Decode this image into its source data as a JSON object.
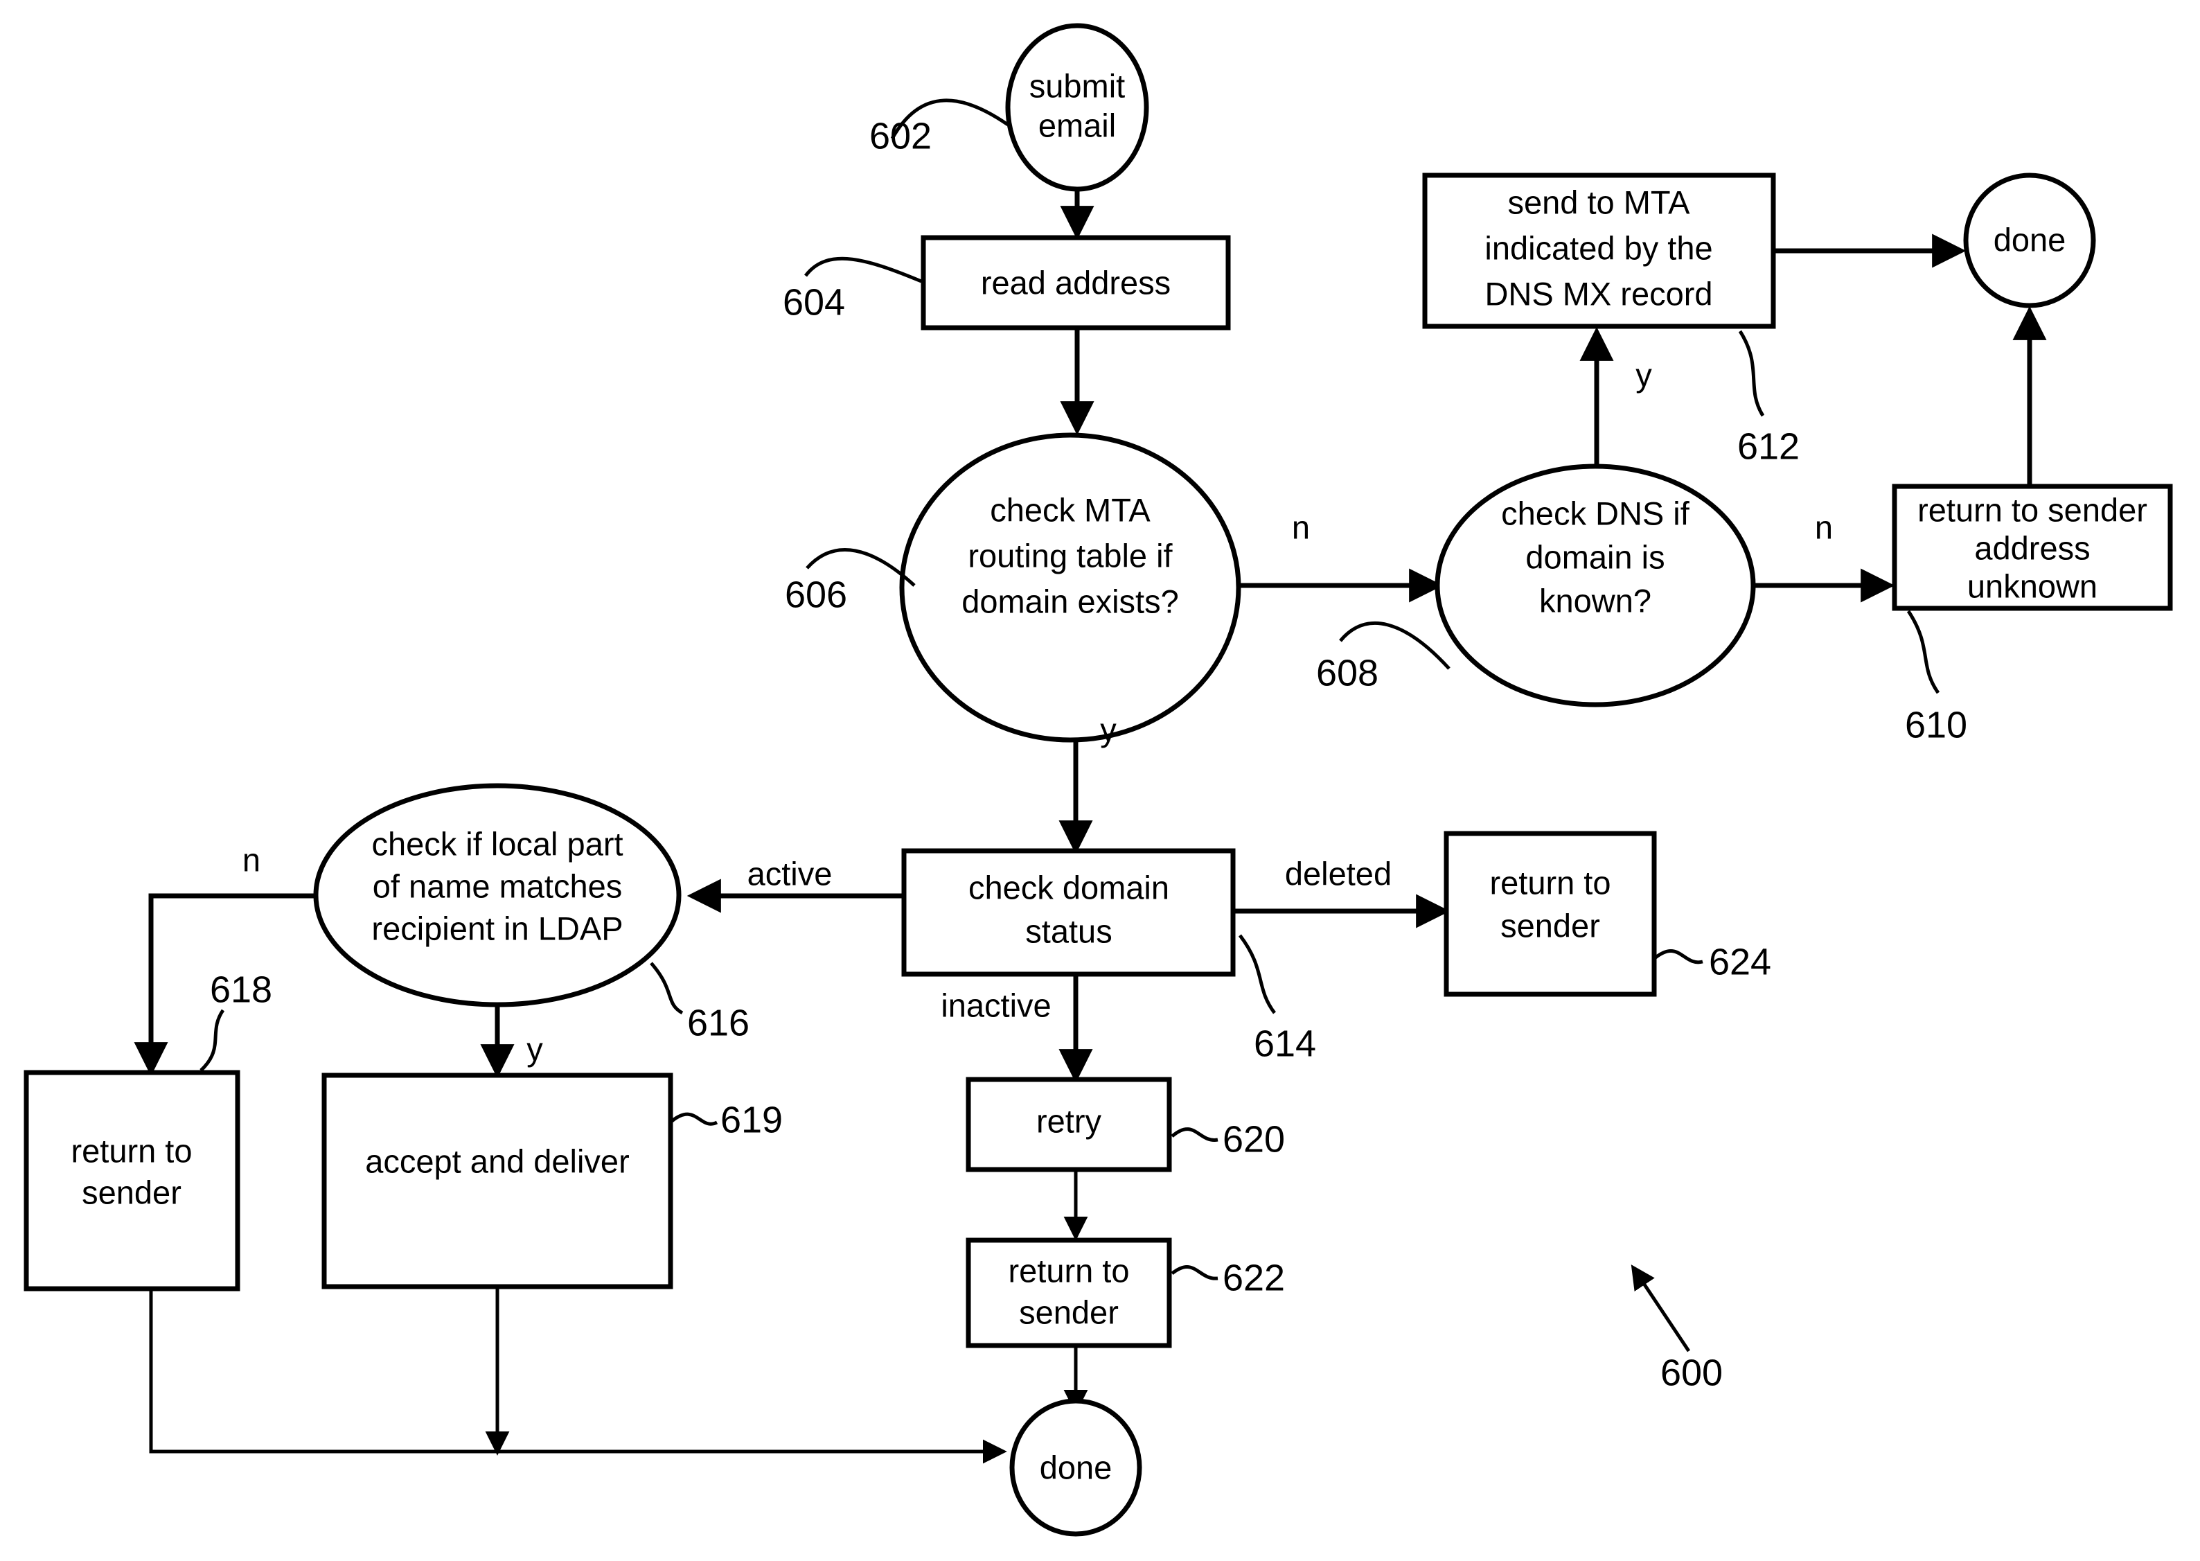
{
  "diagram": {
    "title_ref": "600",
    "type": "flowchart",
    "nodes": [
      {
        "id": "n602",
        "ref": "602",
        "shape": "ellipse",
        "lines": [
          "submit",
          "email"
        ]
      },
      {
        "id": "n604",
        "ref": "604",
        "shape": "rect",
        "lines": [
          "read address"
        ]
      },
      {
        "id": "n606",
        "ref": "606",
        "shape": "ellipse",
        "lines": [
          "check MTA",
          "routing table if",
          "domain exists?"
        ]
      },
      {
        "id": "n608",
        "ref": "608",
        "shape": "ellipse",
        "lines": [
          "check DNS if",
          "domain is",
          "known?"
        ]
      },
      {
        "id": "n610",
        "ref": "610",
        "shape": "rect",
        "lines": [
          "return to sender",
          "address",
          "unknown"
        ]
      },
      {
        "id": "n612",
        "ref": "612",
        "shape": "rect",
        "lines": [
          "send to MTA",
          "indicated by the",
          "DNS MX record"
        ]
      },
      {
        "id": "n_done_top",
        "ref": "",
        "shape": "ellipse",
        "lines": [
          "done"
        ]
      },
      {
        "id": "n614",
        "ref": "614",
        "shape": "rect",
        "lines": [
          "check domain",
          "status"
        ]
      },
      {
        "id": "n616",
        "ref": "616",
        "shape": "ellipse",
        "lines": [
          "check if local part",
          "of name matches",
          "recipient in LDAP"
        ]
      },
      {
        "id": "n618",
        "ref": "618",
        "shape": "rect",
        "lines": [
          "return to",
          "sender"
        ]
      },
      {
        "id": "n619",
        "ref": "619",
        "shape": "rect",
        "lines": [
          "accept and deliver"
        ]
      },
      {
        "id": "n620",
        "ref": "620",
        "shape": "rect",
        "lines": [
          "retry"
        ]
      },
      {
        "id": "n622",
        "ref": "622",
        "shape": "rect",
        "lines": [
          "return to",
          "sender"
        ]
      },
      {
        "id": "n624",
        "ref": "624",
        "shape": "rect",
        "lines": [
          "return to",
          "sender"
        ]
      },
      {
        "id": "n_done_bottom",
        "ref": "",
        "shape": "ellipse",
        "lines": [
          "done"
        ]
      }
    ],
    "edge_labels": {
      "mta_no": "n",
      "mta_yes": "y",
      "dns_no": "n",
      "dns_yes": "y",
      "status_deleted": "deleted",
      "status_inactive": "inactive",
      "status_active": "active",
      "ldap_no": "n",
      "ldap_yes": "y"
    },
    "node_text": {
      "submit_l1": "submit",
      "submit_l2": "email",
      "read_address": "read address",
      "mta_l1": "check MTA",
      "mta_l2": "routing table if",
      "mta_l3": "domain exists?",
      "dns_l1": "check DNS if",
      "dns_l2": "domain is",
      "dns_l3": "known?",
      "rts_unknown_l1": "return to sender",
      "rts_unknown_l2": "address",
      "rts_unknown_l3": "unknown",
      "mx_l1": "send to MTA",
      "mx_l2": "indicated by the",
      "mx_l3": "DNS MX record",
      "done_top": "done",
      "status_l1": "check domain",
      "status_l2": "status",
      "ldap_l1": "check if local part",
      "ldap_l2": "of name matches",
      "ldap_l3": "recipient in LDAP",
      "rts618_l1": "return to",
      "rts618_l2": "sender",
      "accept": "accept and deliver",
      "retry": "retry",
      "rts622_l1": "return to",
      "rts622_l2": "sender",
      "rts624_l1": "return to",
      "rts624_l2": "sender",
      "done_bottom": "done"
    },
    "refs": {
      "r602": "602",
      "r604": "604",
      "r606": "606",
      "r608": "608",
      "r610": "610",
      "r612": "612",
      "r614": "614",
      "r616": "616",
      "r618": "618",
      "r619": "619",
      "r620": "620",
      "r622": "622",
      "r624": "624",
      "r600": "600"
    },
    "colors": {
      "stroke": "#000000",
      "fill": "#ffffff",
      "text": "#000000"
    }
  }
}
